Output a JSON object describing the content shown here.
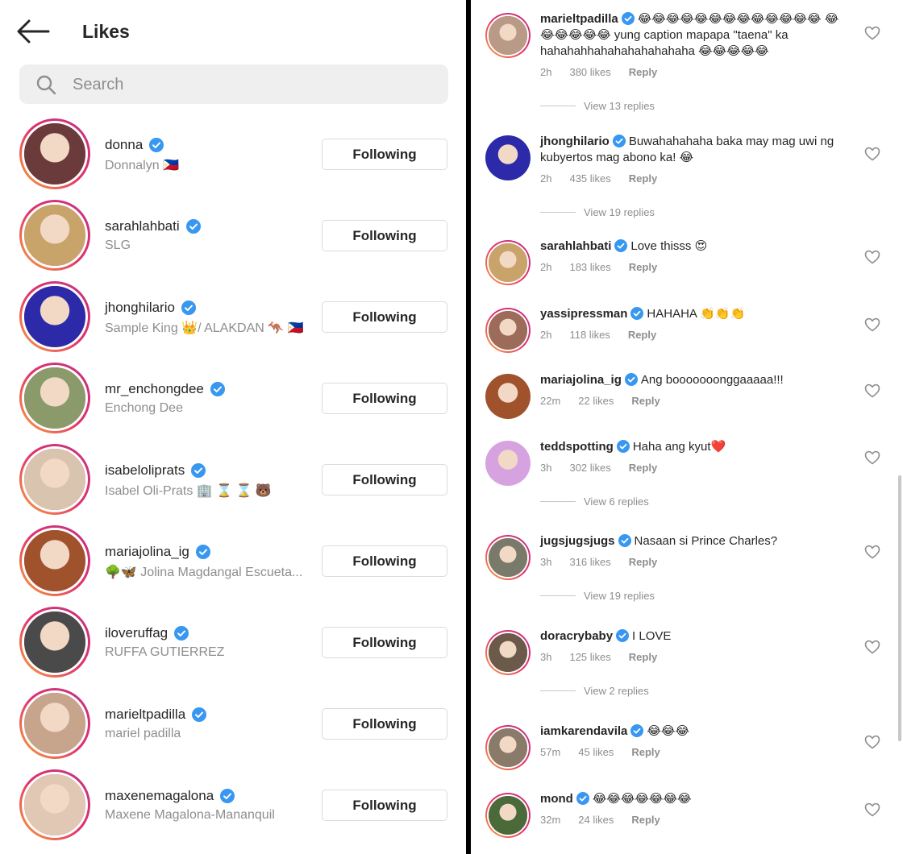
{
  "likes_panel": {
    "title": "Likes",
    "back_icon": "arrow-left-icon",
    "search": {
      "placeholder": "Search",
      "value": ""
    },
    "button_label": "Following",
    "users": [
      {
        "username": "donna",
        "fullname": "Donnalyn 🇵🇭",
        "avatar_color": "#6b3a3a"
      },
      {
        "username": "sarahlahbati",
        "fullname": "SLG",
        "avatar_color": "#c9a46a"
      },
      {
        "username": "jhonghilario",
        "fullname": "Sample King 👑/ ALAKDAN 🦘 🇵🇭",
        "avatar_color": "#2c2aa8"
      },
      {
        "username": "mr_enchongdee",
        "fullname": "Enchong Dee",
        "avatar_color": "#8a9a6a"
      },
      {
        "username": "isabeloliprats",
        "fullname": "Isabel Oli-Prats 🏢 ⌛ ⌛ 🐻",
        "avatar_color": "#d9c4b0"
      },
      {
        "username": "mariajolina_ig",
        "fullname": "🌳🦋 Jolina Magdangal Escueta...",
        "avatar_color": "#a0522d"
      },
      {
        "username": "iloveruffag",
        "fullname": "RUFFA GUTIERREZ",
        "avatar_color": "#4a4a4a"
      },
      {
        "username": "marieltpadilla",
        "fullname": "mariel padilla",
        "avatar_color": "#c7a58c"
      },
      {
        "username": "maxenemagalona",
        "fullname": "Maxene Magalona-Mananquil",
        "avatar_color": "#e0c8b4"
      }
    ]
  },
  "comments_panel": {
    "reply_label": "Reply",
    "comments": [
      {
        "username": "marieltpadilla",
        "verified": true,
        "text": "😂😂😂😂😂😂😂😂😂😂😂😂😂 😂😂😂😂😂😂 yung caption mapapa \"taena\" ka hahahahhahahahahahahaha 😂😂😂😂😂",
        "time": "2h",
        "likes": "380 likes",
        "view_replies": "View 13 replies",
        "avatar_color": "#b89a86",
        "ring": true
      },
      {
        "username": "jhonghilario",
        "verified": true,
        "text": "Buwahahahaha baka may mag uwi ng kubyertos mag abono ka! 😂",
        "time": "2h",
        "likes": "435 likes",
        "view_replies": "View 19 replies",
        "avatar_color": "#2c2aa8",
        "ring": false
      },
      {
        "username": "sarahlahbati",
        "verified": true,
        "text": "Love thisss 😍",
        "time": "2h",
        "likes": "183 likes",
        "view_replies": "",
        "avatar_color": "#c9a46a",
        "ring": true
      },
      {
        "username": "yassipressman",
        "verified": true,
        "text": "HAHAHA 👏👏👏",
        "time": "2h",
        "likes": "118 likes",
        "view_replies": "",
        "avatar_color": "#9c6b5a",
        "ring": true
      },
      {
        "username": "mariajolina_ig",
        "verified": true,
        "text": "Ang booooooonggaaaaa!!!",
        "time": "22m",
        "likes": "22 likes",
        "view_replies": "",
        "avatar_color": "#a0522d",
        "ring": false
      },
      {
        "username": "teddspotting",
        "verified": true,
        "text": "Haha ang kyut❤️",
        "time": "3h",
        "likes": "302 likes",
        "view_replies": "View 6 replies",
        "avatar_color": "#d6a3e0",
        "ring": false
      },
      {
        "username": "jugsjugsjugs",
        "verified": true,
        "text": "Nasaan si Prince Charles?",
        "time": "3h",
        "likes": "316 likes",
        "view_replies": "View 19 replies",
        "avatar_color": "#7a7a6a",
        "ring": true
      },
      {
        "username": "doracrybaby",
        "verified": true,
        "text": "I LOVE",
        "time": "3h",
        "likes": "125 likes",
        "view_replies": "View 2 replies",
        "avatar_color": "#6b5a4a",
        "ring": true
      },
      {
        "username": "iamkarendavila",
        "verified": true,
        "text": "😂😂😂",
        "time": "57m",
        "likes": "45 likes",
        "view_replies": "",
        "avatar_color": "#8a7a6a",
        "ring": true
      },
      {
        "username": "mond",
        "verified": true,
        "text": "😂😂😂😂😂😂😂",
        "time": "32m",
        "likes": "24 likes",
        "view_replies": "",
        "avatar_color": "#4a6a3a",
        "ring": true
      }
    ]
  },
  "colors": {
    "verified_blue": "#3897f0",
    "ring_start": "#f9a53b",
    "ring_end": "#c13584",
    "muted": "#8e8e8e"
  }
}
